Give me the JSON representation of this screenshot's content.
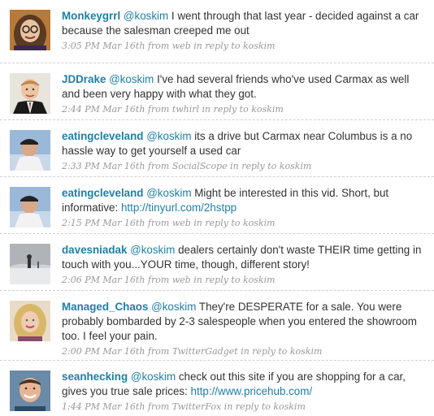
{
  "tweets": [
    {
      "user": "Monkeygrrl",
      "mention": "@koskim",
      "text": " I went through that last year - decided against a car because the salesman creeped me out",
      "link": "",
      "time": "3:05 PM Mar 16th",
      "from_label": " from ",
      "source": "web",
      "reply_label": " in reply to ",
      "reply_to": "koskim",
      "avatar_icon": "woman-glasses-avatar"
    },
    {
      "user": "JDDrake",
      "mention": "@koskim",
      "text": " I've had several friends who've used Carmax as well and been very happy with what they got.",
      "link": "",
      "time": "2:44 PM Mar 16th",
      "from_label": " from ",
      "source": "twhirl",
      "reply_label": " in reply to ",
      "reply_to": "koskim",
      "avatar_icon": "man-suit-avatar"
    },
    {
      "user": "eatingcleveland",
      "mention": "@koskim",
      "text": " its a drive but Carmax near Columbus is a no hassle way to get yourself a used car",
      "link": "",
      "time": "2:33 PM Mar 16th",
      "from_label": " from ",
      "source": "SocialScope",
      "reply_label": " in reply to ",
      "reply_to": "koskim",
      "avatar_icon": "man-cap-avatar"
    },
    {
      "user": "eatingcleveland",
      "mention": "@koskim",
      "text": " Might be interested in this vid. Short, but informative: ",
      "link": "http://tinyurl.com/2hstpp",
      "time": "2:15 PM Mar 16th",
      "from_label": " from ",
      "source": "web",
      "reply_label": " in reply to ",
      "reply_to": "koskim",
      "avatar_icon": "man-cap-avatar"
    },
    {
      "user": "davesniadak",
      "mention": "@koskim",
      "text": " dealers certainly don't waste THEIR time getting in touch with you...YOUR time, though, different story!",
      "link": "",
      "time": "2:06 PM Mar 16th",
      "from_label": " from ",
      "source": "web",
      "reply_label": " in reply to ",
      "reply_to": "koskim",
      "avatar_icon": "snowy-landscape-avatar"
    },
    {
      "user": "Managed_Chaos",
      "mention": "@koskim",
      "text": " They're DESPERATE for a sale. You were probably bombarded by 2-3 salespeople when you entered the showroom too. I feel your pain.",
      "link": "",
      "time": "2:00 PM Mar 16th",
      "from_label": " from ",
      "source": "TwitterGadget",
      "reply_label": " in reply to ",
      "reply_to": "koskim",
      "avatar_icon": "blonde-woman-avatar"
    },
    {
      "user": "seanhecking",
      "mention": "@koskim",
      "text": " check out this site if you are shopping for a car, gives you true sale prices: ",
      "link": "http://www.pricehub.com/",
      "time": "1:44 PM Mar 16th",
      "from_label": " from ",
      "source": "TwitterFox",
      "reply_label": " in reply to ",
      "reply_to": "koskim",
      "avatar_icon": "smiling-man-avatar"
    }
  ],
  "colors": {
    "link": "#1e7fa8",
    "text": "#333333",
    "meta": "#999999",
    "divider": "#cfcfcf"
  }
}
